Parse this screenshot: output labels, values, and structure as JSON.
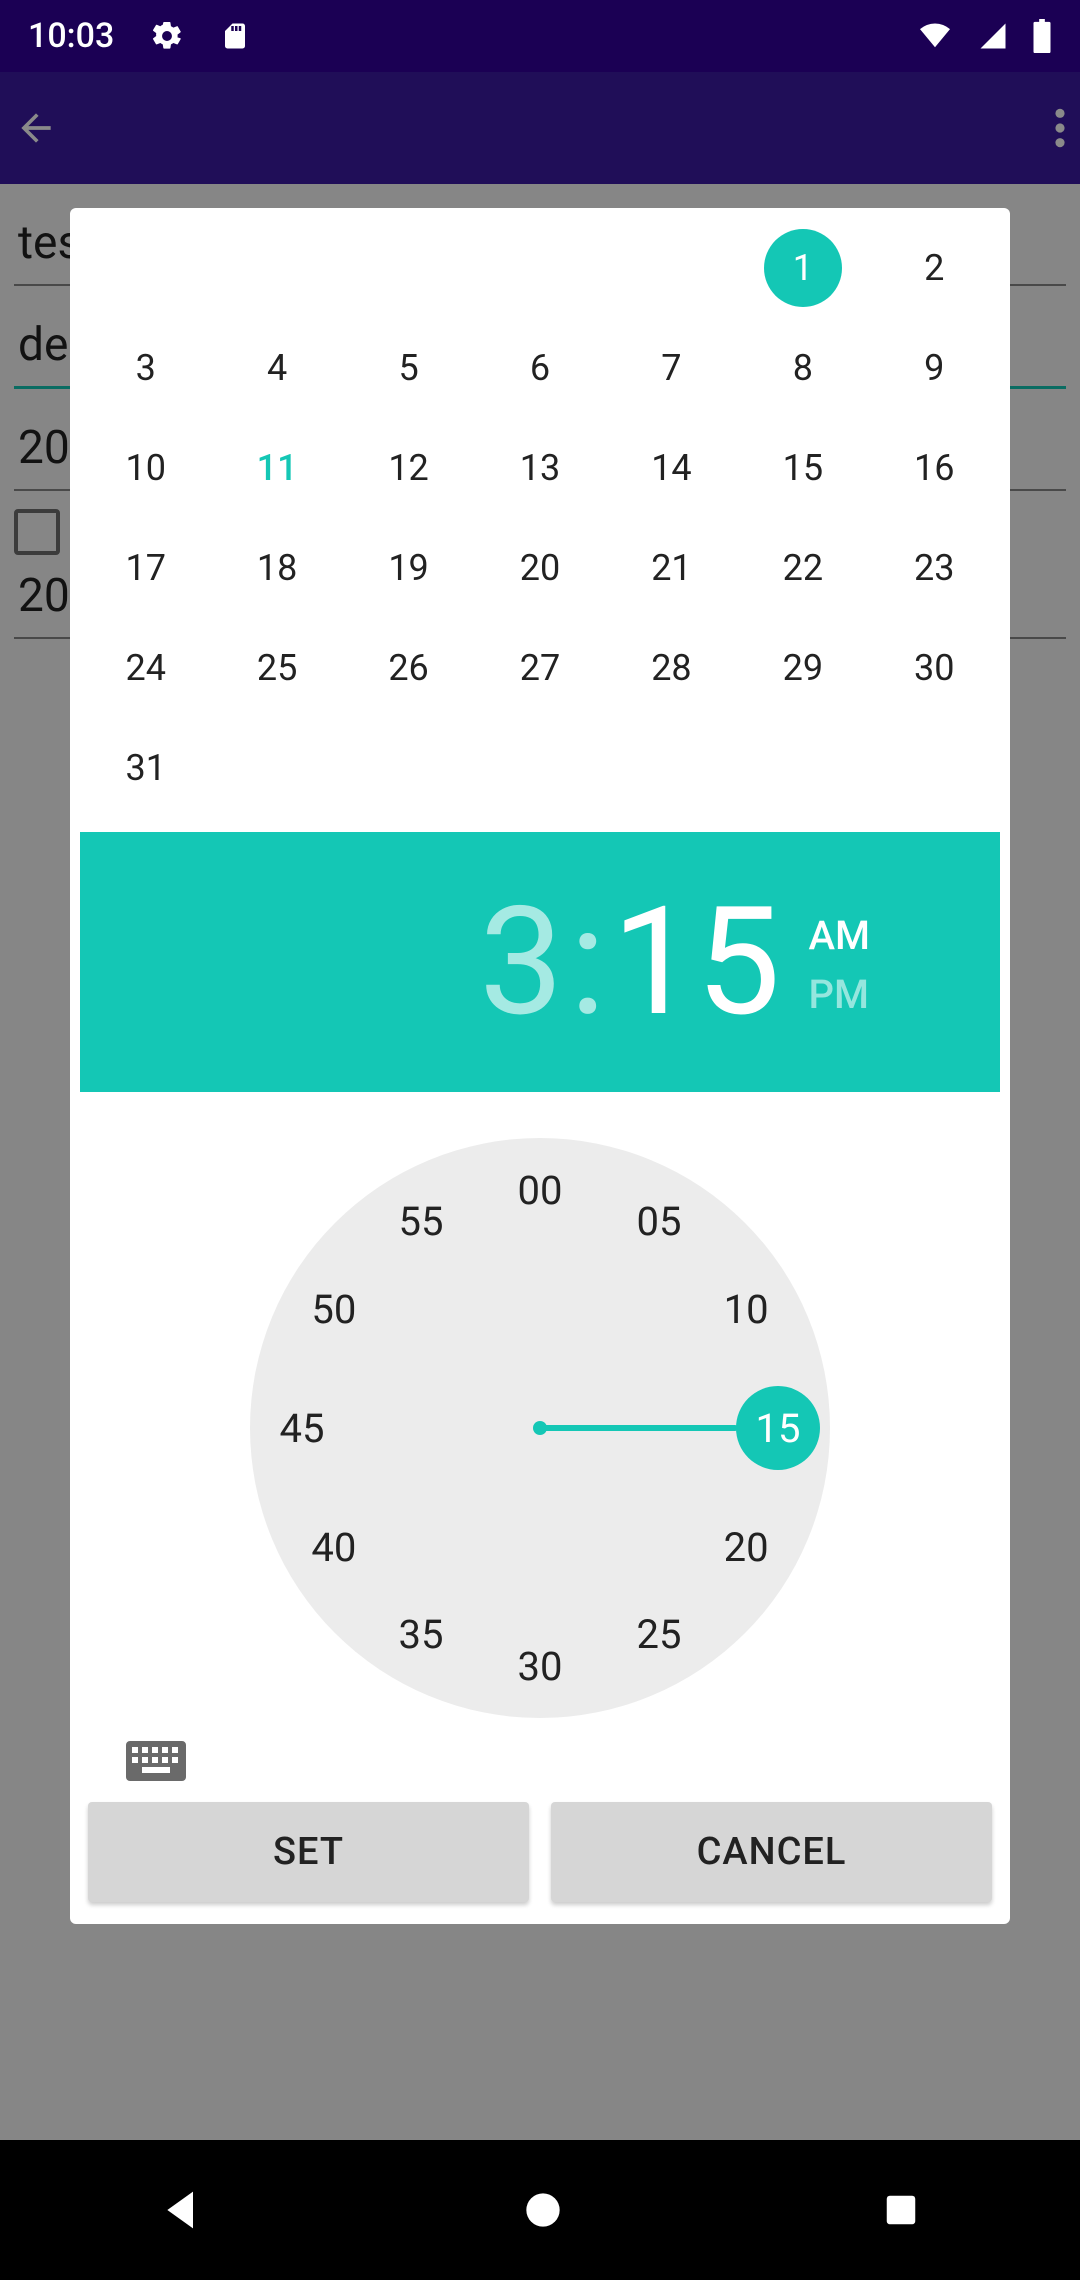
{
  "status": {
    "time": "10:03"
  },
  "bg": {
    "title": "tes",
    "desc": "des",
    "year1": "20",
    "year2": "20"
  },
  "calendar": {
    "leading_blanks": 5,
    "days_in_month": 31,
    "selected_day": 1,
    "today": 11
  },
  "time": {
    "hour": "3",
    "minute": "15",
    "am": "AM",
    "pm": "PM",
    "period": "AM"
  },
  "clock": {
    "labels": [
      "00",
      "05",
      "10",
      "15",
      "20",
      "25",
      "30",
      "35",
      "40",
      "45",
      "50",
      "55"
    ],
    "selected_index": 3
  },
  "buttons": {
    "set": "SET",
    "cancel": "CANCEL"
  }
}
